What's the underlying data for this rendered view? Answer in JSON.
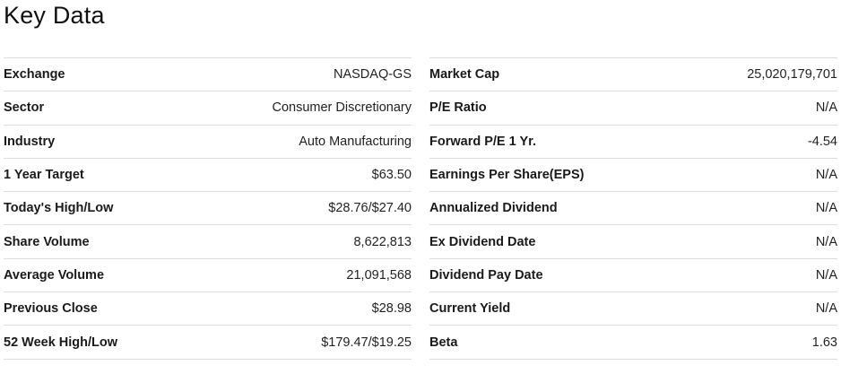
{
  "title": "Key Data",
  "left": [
    {
      "label": "Exchange",
      "value": "NASDAQ-GS"
    },
    {
      "label": "Sector",
      "value": "Consumer Discretionary"
    },
    {
      "label": "Industry",
      "value": "Auto Manufacturing"
    },
    {
      "label": "1 Year Target",
      "value": "$63.50"
    },
    {
      "label": "Today's High/Low",
      "value": "$28.76/$27.40"
    },
    {
      "label": "Share Volume",
      "value": "8,622,813"
    },
    {
      "label": "Average Volume",
      "value": "21,091,568"
    },
    {
      "label": "Previous Close",
      "value": "$28.98"
    },
    {
      "label": "52 Week High/Low",
      "value": "$179.47/$19.25"
    }
  ],
  "right": [
    {
      "label": "Market Cap",
      "value": "25,020,179,701"
    },
    {
      "label": "P/E Ratio",
      "value": "N/A"
    },
    {
      "label": "Forward P/E 1 Yr.",
      "value": "-4.54"
    },
    {
      "label": "Earnings Per Share(EPS)",
      "value": "N/A"
    },
    {
      "label": "Annualized Dividend",
      "value": "N/A"
    },
    {
      "label": "Ex Dividend Date",
      "value": "N/A"
    },
    {
      "label": "Dividend Pay Date",
      "value": "N/A"
    },
    {
      "label": "Current Yield",
      "value": "N/A"
    },
    {
      "label": "Beta",
      "value": "1.63"
    }
  ]
}
